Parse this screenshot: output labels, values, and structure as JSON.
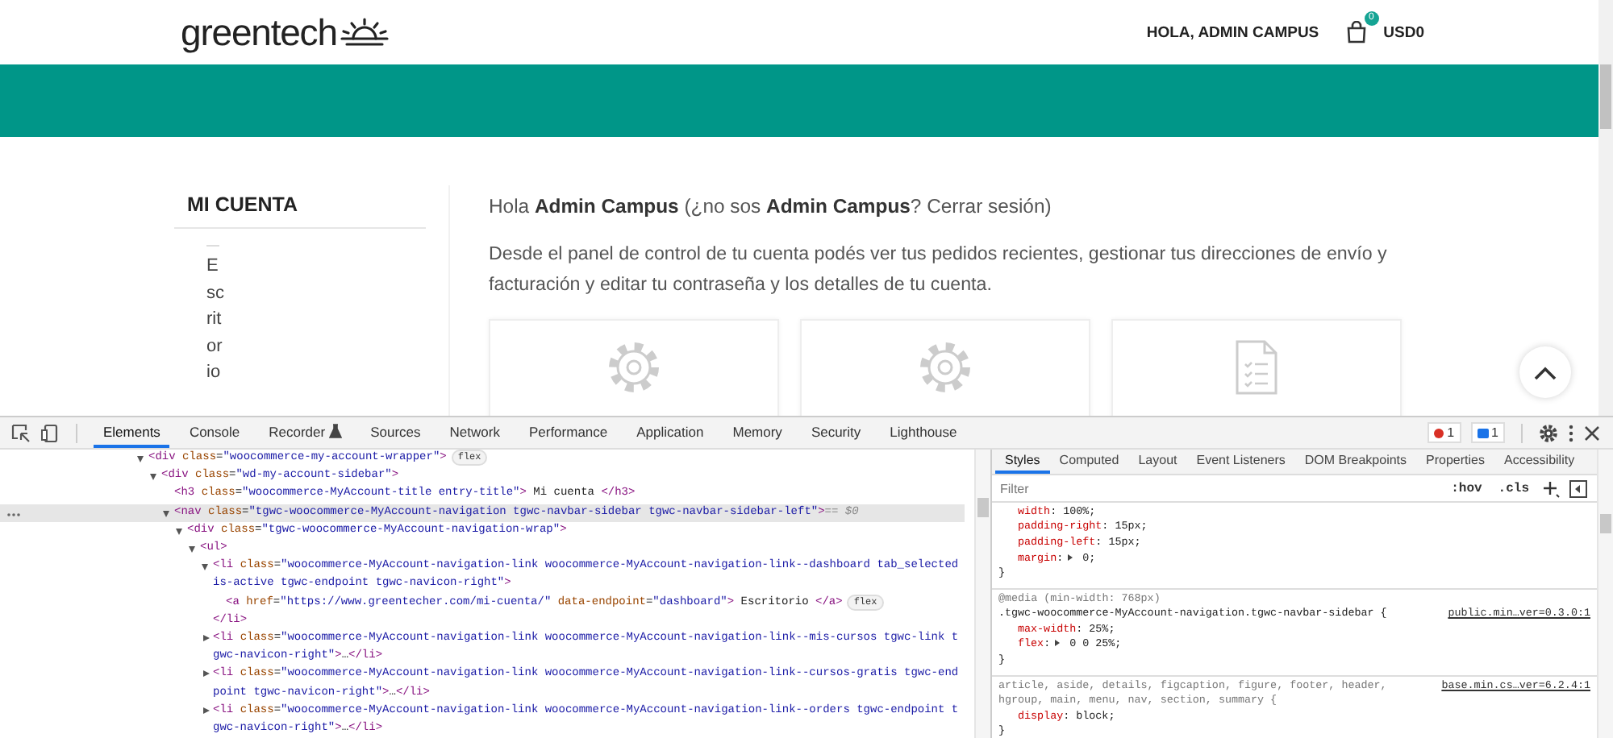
{
  "page": {
    "header": {
      "logo": "greentech",
      "greeting": "HOLA, ADMIN CAMPUS",
      "cart_count": "0",
      "cart_total": "USD0"
    },
    "sidebar": {
      "title": "MI CUENTA",
      "items": [
        {
          "label": "Escritorio"
        }
      ]
    },
    "greeting": {
      "text": "Hola **Admin Campus** (¿no sos **Admin Campus**? ",
      "link": "Cerrar sesión",
      "end": ")"
    },
    "intro": "Desde el panel de control de tu cuenta podés ver tus pedidos recientes, gestionar tus direcciones de envío y facturación y editar tu contraseña y los detalles de tu cuenta.",
    "cards": [
      {
        "kind": "settings"
      },
      {
        "kind": "settings"
      },
      {
        "kind": "document"
      }
    ]
  },
  "devtools": {
    "tabs": [
      {
        "label": "Elements",
        "selected": true,
        "kind": "plain"
      },
      {
        "label": "Console",
        "selected": false,
        "kind": "plain"
      },
      {
        "label": "Recorder",
        "selected": false,
        "kind": "experimental"
      },
      {
        "label": "Sources",
        "selected": false,
        "kind": "plain"
      },
      {
        "label": "Network",
        "selected": false,
        "kind": "plain"
      },
      {
        "label": "Performance",
        "selected": false,
        "kind": "plain"
      },
      {
        "label": "Application",
        "selected": false,
        "kind": "plain"
      },
      {
        "label": "Memory",
        "selected": false,
        "kind": "plain"
      },
      {
        "label": "Security",
        "selected": false,
        "kind": "plain"
      },
      {
        "label": "Lighthouse",
        "selected": false,
        "kind": "plain"
      }
    ],
    "errors": "1",
    "messages": "1",
    "dom_tree": [
      {
        "code": "<div class=\"woocommerce-my-account-wrapper\">",
        "badge": "flex",
        "expanded": true,
        "selected": false,
        "children": [
          {
            "code": "<div class=\"wd-my-account-sidebar\">",
            "expanded": true,
            "selected": false,
            "children": [
              {
                "code": "<h3 class=\"woocommerce-MyAccount-title entry-title\"> Mi cuenta </h3>",
                "selected": false
              },
              {
                "code": "<nav class=\"tgwc-woocommerce-MyAccount-navigation tgwc-navbar-sidebar tgwc-navbar-sidebar-left\">",
                "marker": "== $0",
                "expanded": true,
                "selected": true,
                "children": [
                  {
                    "code": "<div class=\"tgwc-woocommerce-MyAccount-navigation-wrap\">",
                    "expanded": true,
                    "selected": false,
                    "children": [
                      {
                        "code": "<ul>",
                        "expanded": true,
                        "selected": false,
                        "children": [
                          {
                            "code": "<li class=\"woocommerce-MyAccount-navigation-link woocommerce-MyAccount-navigation-link--dashboard tab_selected is-active tgwc-endpoint tgwc-navicon-right\">",
                            "expanded": true,
                            "selected": false,
                            "close": "</li>",
                            "children": [
                              {
                                "code": "<a href=\"https://www.greentecher.com/mi-cuenta/\" data-endpoint=\"dashboard\"> Escritorio </a>",
                                "badge": "flex",
                                "selected": false
                              }
                            ]
                          },
                          {
                            "code": "<li class=\"woocommerce-MyAccount-navigation-link woocommerce-MyAccount-navigation-link--mis-cursos tgwc-link tgwc-navicon-right\">…</li>",
                            "expanded": false,
                            "selected": false
                          },
                          {
                            "code": "<li class=\"woocommerce-MyAccount-navigation-link woocommerce-MyAccount-navigation-link--cursos-gratis tgwc-endpoint tgwc-navicon-right\">…</li>",
                            "expanded": false,
                            "selected": false
                          },
                          {
                            "code": "<li class=\"woocommerce-MyAccount-navigation-link woocommerce-MyAccount-navigation-link--orders tgwc-endpoint tgwc-navicon-right\">…</li>",
                            "expanded": false,
                            "selected": false
                          }
                        ]
                      }
                    ]
                  }
                ]
              }
            ]
          }
        ]
      }
    ],
    "style_tabs": [
      {
        "label": "Styles",
        "selected": true
      },
      {
        "label": "Computed",
        "selected": false
      },
      {
        "label": "Layout",
        "selected": false
      },
      {
        "label": "Event Listeners",
        "selected": false
      },
      {
        "label": "DOM Breakpoints",
        "selected": false
      },
      {
        "label": "Properties",
        "selected": false
      },
      {
        "label": "Accessibility",
        "selected": false
      }
    ],
    "filter": {
      "placeholder": "Filter"
    },
    "filter_tools": [
      ":hov",
      ".cls"
    ],
    "rules": [
      {
        "decls": [
          {
            "text": "width: 100%;"
          },
          {
            "text": "padding-right: 15px;"
          },
          {
            "text": "padding-left: 15px;"
          },
          {
            "text": "margin: 0;",
            "expandable": true
          }
        ],
        "close": "}"
      },
      {
        "media": "@media (min-width: 768px)",
        "selector": ".tgwc-woocommerce-MyAccount-navigation.tgwc-navbar-sidebar {",
        "source": "public.min…ver=0.3.0:1",
        "decls": [
          {
            "text": "max-width: 25%;"
          },
          {
            "text": "flex: 0 0 25%;",
            "expandable": true
          }
        ],
        "close": "}"
      },
      {
        "selector": "article, aside, details, figcaption, figure, footer, header, hgroup, main, menu, nav, section, summary {",
        "source": "base.min.cs…ver=6.2.4:1",
        "decls": [
          {
            "text": "display: block;"
          }
        ],
        "close": "}"
      }
    ]
  }
}
